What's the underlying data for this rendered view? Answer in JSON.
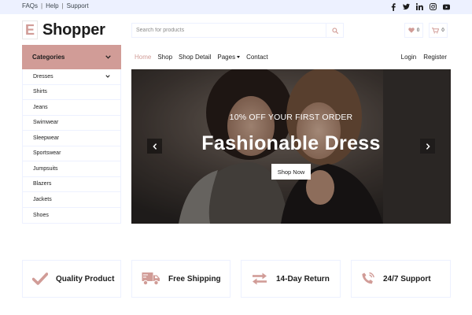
{
  "topbar": {
    "links": [
      "FAQs",
      "Help",
      "Support"
    ],
    "social_icons": [
      "facebook-icon",
      "twitter-icon",
      "linkedin-icon",
      "instagram-icon",
      "youtube-icon"
    ]
  },
  "header": {
    "logo_mark": "E",
    "logo_name": "Shopper",
    "search_placeholder": "Search for products",
    "wishlist_count": "0",
    "cart_count": "0"
  },
  "categories": {
    "title": "Categories",
    "items": [
      "Dresses",
      "Shirts",
      "Jeans",
      "Swimwear",
      "Sleepwear",
      "Sportswear",
      "Jumpsuits",
      "Blazers",
      "Jackets",
      "Shoes"
    ]
  },
  "nav": {
    "items": [
      "Home",
      "Shop",
      "Shop Detail",
      "Pages",
      "Contact"
    ],
    "active": "Home",
    "auth": [
      "Login",
      "Register"
    ]
  },
  "hero": {
    "subtitle": "10% OFF YOUR FIRST ORDER",
    "title": "Fashionable Dress",
    "cta": "Shop Now"
  },
  "features": [
    {
      "label": "Quality Product",
      "icon": "check-icon"
    },
    {
      "label": "Free Shipping",
      "icon": "shipping-icon"
    },
    {
      "label": "14-Day Return",
      "icon": "exchange-icon"
    },
    {
      "label": "24/7 Support",
      "icon": "phone-icon"
    }
  ],
  "colors": {
    "accent": "#d19c97",
    "topbar_bg": "#edf1ff",
    "text": "#1c1c1c"
  }
}
